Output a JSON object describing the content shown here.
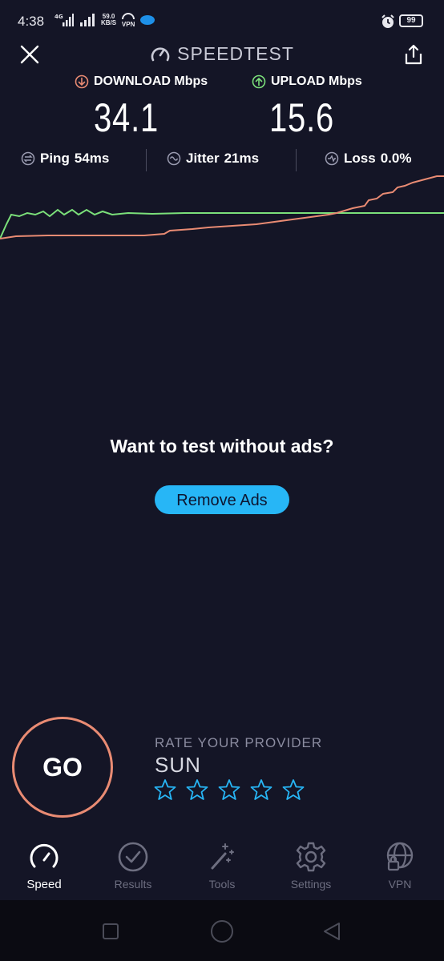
{
  "status_bar": {
    "time": "4:38",
    "net_speed_top": "59.0",
    "net_speed_unit": "KB/S",
    "vpn_label": "VPN",
    "signal_label": "4G",
    "battery": "99"
  },
  "header": {
    "title": "SPEEDTEST"
  },
  "metrics": {
    "download_label": "DOWNLOAD Mbps",
    "download_value": "34.1",
    "upload_label": "UPLOAD Mbps",
    "upload_value": "15.6",
    "download_color": "#e98b73",
    "upload_color": "#7be07a"
  },
  "stats": {
    "ping_label": "Ping",
    "ping_value": "54ms",
    "jitter_label": "Jitter",
    "jitter_value": "21ms",
    "loss_label": "Loss",
    "loss_value": "0.0%"
  },
  "ads": {
    "prompt": "Want to test without ads?",
    "button_label": "Remove Ads",
    "button_color": "#27b6f6"
  },
  "go": {
    "label": "GO",
    "ring_color": "#e98b73"
  },
  "rating": {
    "heading": "RATE YOUR PROVIDER",
    "provider": "SUN",
    "stars_total": 5,
    "stars_filled": 0,
    "star_color": "#27b6f6"
  },
  "nav": {
    "items": [
      {
        "label": "Speed",
        "icon": "speedometer-icon",
        "active": true
      },
      {
        "label": "Results",
        "icon": "check-circle-icon",
        "active": false
      },
      {
        "label": "Tools",
        "icon": "magic-wand-icon",
        "active": false
      },
      {
        "label": "Settings",
        "icon": "gear-icon",
        "active": false
      },
      {
        "label": "VPN",
        "icon": "globe-lock-icon",
        "active": false
      }
    ]
  },
  "system_nav": {
    "icons": [
      "recents-square-icon",
      "home-circle-icon",
      "back-triangle-icon"
    ]
  }
}
